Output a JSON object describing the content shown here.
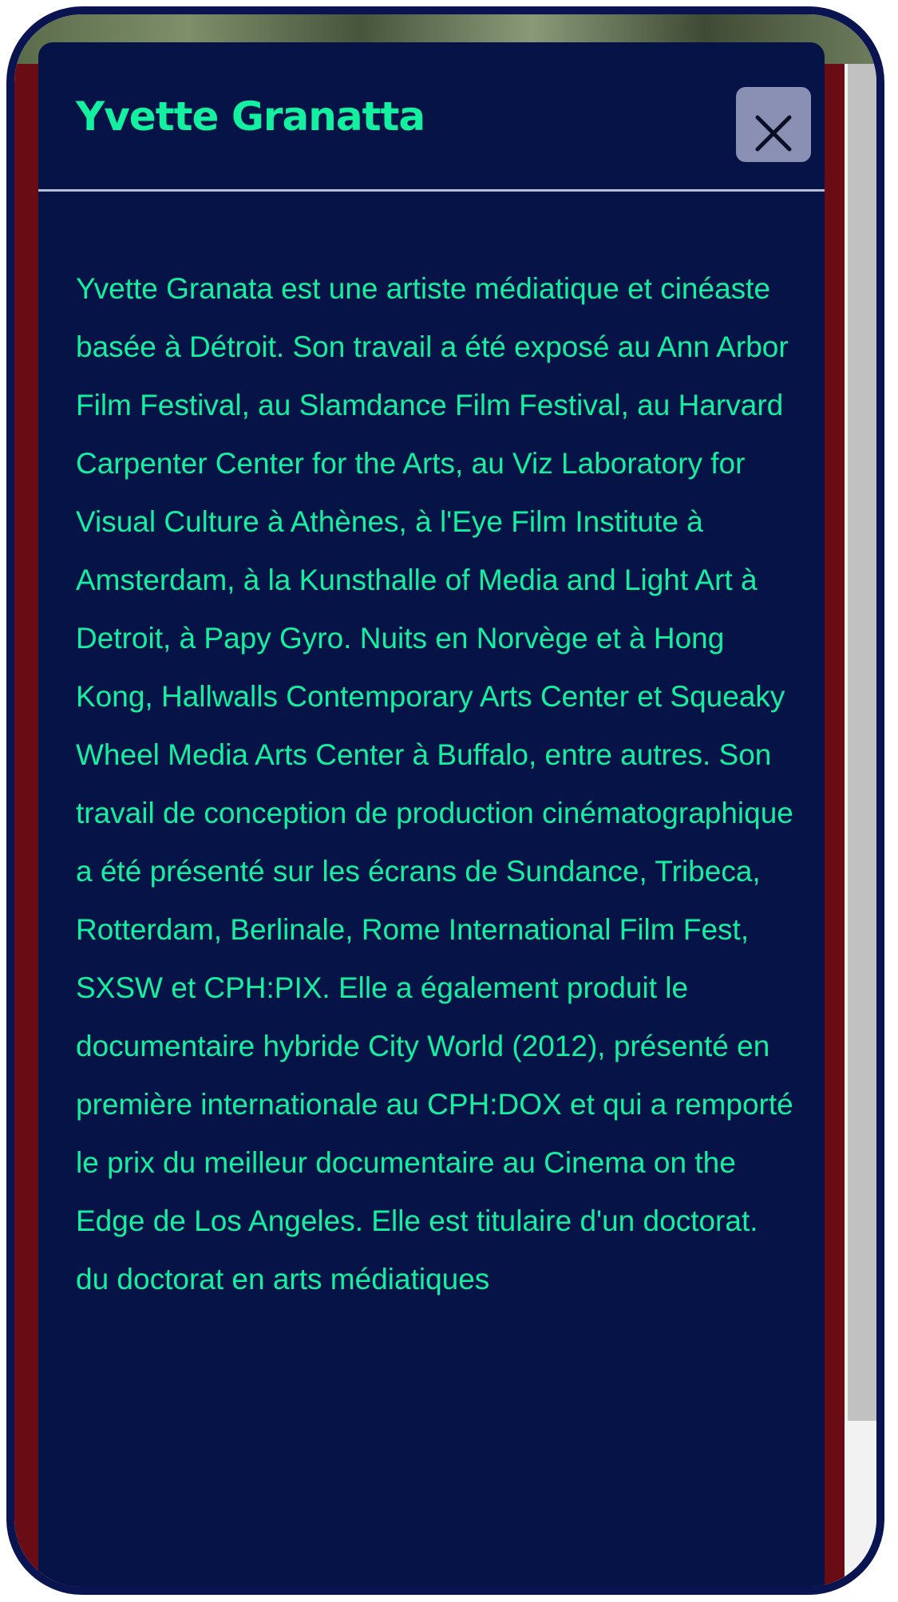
{
  "modal": {
    "title": "Yvette Granatta",
    "close_icon": "close-icon",
    "bio": "Yvette Granata est une artiste médiatique et cinéaste basée à Détroit. Son travail a été exposé au Ann Arbor Film Festival, au Slamdance Film Festival, au Harvard Carpenter Center for the Arts, au Viz Laboratory for Visual Culture à Athènes, à l'Eye Film Institute à Amsterdam, à la Kunsthalle of Media and Light Art à Detroit, à Papy Gyro. Nuits en Norvège et à Hong Kong, Hallwalls Contemporary Arts Center et Squeaky Wheel Media Arts Center à Buffalo, entre autres. Son travail de conception de production cinématographique a été présenté sur les écrans de Sundance, Tribeca, Rotterdam, Berlinale, Rome International Film Fest, SXSW et CPH:PIX. Elle a également produit le documentaire hybride City World (2012), présenté en première internationale au CPH:DOX et qui a remporté le prix du meilleur documentaire au Cinema on the Edge de Los Angeles. Elle est titulaire d'un doctorat. du doctorat en arts médiatiques"
  },
  "colors": {
    "modal_background": "#061347",
    "accent_text": "#12f0a0",
    "close_button": "#8a90b3",
    "backdrop": "#6a0c14",
    "frame": "#0a1450"
  }
}
